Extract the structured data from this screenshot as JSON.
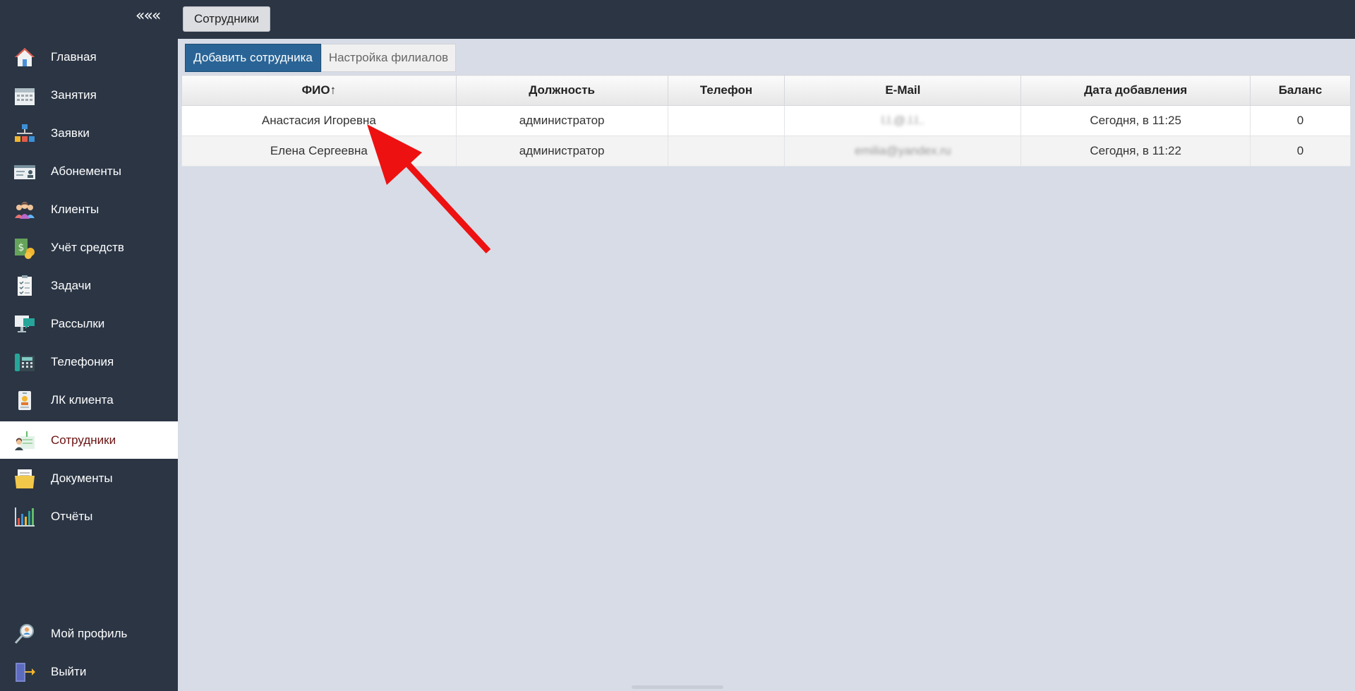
{
  "sidebar": {
    "collapse_label": "«««",
    "items": [
      {
        "label": "Главная",
        "icon": "home-icon"
      },
      {
        "label": "Занятия",
        "icon": "calendar-icon"
      },
      {
        "label": "Заявки",
        "icon": "requests-tree-icon"
      },
      {
        "label": "Абонементы",
        "icon": "membership-card-icon"
      },
      {
        "label": "Клиенты",
        "icon": "clients-group-icon"
      },
      {
        "label": "Учёт средств",
        "icon": "money-coins-icon"
      },
      {
        "label": "Задачи",
        "icon": "tasks-checklist-icon"
      },
      {
        "label": "Рассылки",
        "icon": "mailing-monitor-icon"
      },
      {
        "label": "Телефония",
        "icon": "telephone-icon"
      },
      {
        "label": "ЛК клиента",
        "icon": "client-badge-icon"
      },
      {
        "label": "Сотрудники",
        "icon": "employees-icon",
        "active": true
      },
      {
        "label": "Документы",
        "icon": "documents-folder-icon"
      },
      {
        "label": "Отчёты",
        "icon": "reports-bar-chart-icon"
      }
    ],
    "bottom_items": [
      {
        "label": "Мой профиль",
        "icon": "profile-search-icon"
      },
      {
        "label": "Выйти",
        "icon": "logout-door-icon"
      }
    ]
  },
  "header": {
    "page_tab": "Сотрудники"
  },
  "toolbar": {
    "add_employee": "Добавить сотрудника",
    "branch_settings": "Настройка филиалов"
  },
  "table": {
    "columns": [
      "ФИО↑",
      "Должность",
      "Телефон",
      "E-Mail",
      "Дата добавления",
      "Баланс"
    ],
    "rows": [
      {
        "name": "Анастасия Игоревна",
        "position": "администратор",
        "phone": "",
        "email": "l.l.@.l.l..",
        "date": "Сегодня, в 11:25",
        "balance": "0"
      },
      {
        "name": "Елена Сергеевна",
        "position": "администратор",
        "phone": "",
        "email": "emilia@yandex.ru",
        "date": "Сегодня, в 11:22",
        "balance": "0"
      }
    ]
  },
  "colors": {
    "sidebar_bg": "#2b3544",
    "content_bg": "#d7dce7",
    "primary_button": "#2a6496",
    "active_item_text": "#6b1111",
    "annotation_arrow": "#ee1111"
  }
}
